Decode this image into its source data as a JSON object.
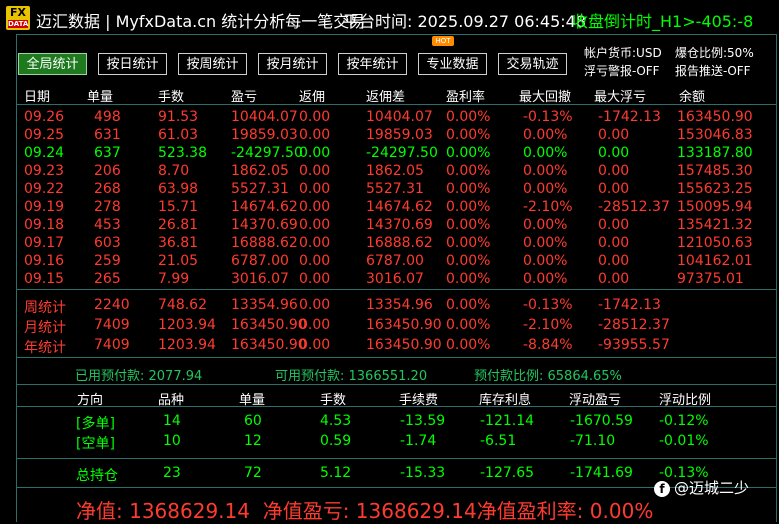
{
  "titlebar": {
    "logo_top": "FX",
    "logo_bottom": "DATA",
    "title": "迈汇数据 | MyfxData.cn  统计分析每一笔交易",
    "time": "平台时间: 2025.09.27 06:45:48",
    "countdown": "收盘倒计时_H1>-405:-8"
  },
  "buttons": [
    {
      "label": "全局统计",
      "active": true
    },
    {
      "label": "按日统计",
      "active": false
    },
    {
      "label": "按周统计",
      "active": false
    },
    {
      "label": "按月统计",
      "active": false
    },
    {
      "label": "按年统计",
      "active": false
    },
    {
      "label": "专业数据",
      "active": false
    },
    {
      "label": "交易轨迹",
      "active": false
    }
  ],
  "hot_badge": "HOT",
  "info": {
    "currency": "帐户货币:USD",
    "ratio": "爆仓比例:50%",
    "alert": "浮亏警报-OFF",
    "report": "报告推送-OFF"
  },
  "table": {
    "headers": [
      "日期",
      "单量",
      "手数",
      "盈亏",
      "返佣",
      "返佣差",
      "盈利率",
      "最大回撤",
      "最大浮亏",
      "余额"
    ],
    "rows": [
      {
        "color": "red",
        "cells": [
          "09.26",
          "498",
          "91.53",
          "10404.07",
          "0.00",
          "10404.07",
          "0.00%",
          "-0.13%",
          "-1742.13",
          "163450.90"
        ]
      },
      {
        "color": "red",
        "cells": [
          "09.25",
          "631",
          "61.03",
          "19859.03",
          "0.00",
          "19859.03",
          "0.00%",
          "0.00%",
          "0.00",
          "153046.83"
        ]
      },
      {
        "color": "green",
        "cells": [
          "09.24",
          "637",
          "523.38",
          "-24297.50",
          "0.00",
          "-24297.50",
          "0.00%",
          "0.00%",
          "0.00",
          "133187.80"
        ]
      },
      {
        "color": "red",
        "cells": [
          "09.23",
          "206",
          "8.70",
          "1862.05",
          "0.00",
          "1862.05",
          "0.00%",
          "0.00%",
          "0.00",
          "157485.30"
        ]
      },
      {
        "color": "red",
        "cells": [
          "09.22",
          "268",
          "63.98",
          "5527.31",
          "0.00",
          "5527.31",
          "0.00%",
          "0.00%",
          "0.00",
          "155623.25"
        ]
      },
      {
        "color": "red",
        "cells": [
          "09.19",
          "278",
          "15.71",
          "14674.62",
          "0.00",
          "14674.62",
          "0.00%",
          "-2.10%",
          "-28512.37",
          "150095.94"
        ]
      },
      {
        "color": "red",
        "cells": [
          "09.18",
          "453",
          "26.81",
          "14370.69",
          "0.00",
          "14370.69",
          "0.00%",
          "0.00%",
          "0.00",
          "135421.32"
        ]
      },
      {
        "color": "red",
        "cells": [
          "09.17",
          "603",
          "36.81",
          "16888.62",
          "0.00",
          "16888.62",
          "0.00%",
          "0.00%",
          "0.00",
          "121050.63"
        ]
      },
      {
        "color": "red",
        "cells": [
          "09.16",
          "259",
          "21.05",
          "6787.00",
          "0.00",
          "6787.00",
          "0.00%",
          "0.00%",
          "0.00",
          "104162.01"
        ]
      },
      {
        "color": "red",
        "cells": [
          "09.15",
          "265",
          "7.99",
          "3016.07",
          "0.00",
          "3016.07",
          "0.00%",
          "0.00%",
          "0.00",
          "97375.01"
        ]
      }
    ],
    "totals": [
      {
        "color": "red",
        "cells": [
          "周统计",
          "2240",
          "748.62",
          "13354.96",
          "0.00",
          "13354.96",
          "0.00%",
          "-0.13%",
          "-1742.13",
          ""
        ]
      },
      {
        "color": "red",
        "cells": [
          "月统计",
          "7409",
          "1203.94",
          "163450.90",
          "0.00",
          "163450.90",
          "0.00%",
          "-2.10%",
          "-28512.37",
          ""
        ]
      },
      {
        "color": "red",
        "cells": [
          "年统计",
          "7409",
          "1203.94",
          "163450.90",
          "0.00",
          "163450.90",
          "0.00%",
          "-8.84%",
          "-93955.57",
          ""
        ]
      }
    ]
  },
  "margin": {
    "used": "已用预付款: 2077.94",
    "available": "可用预付款: 1366551.20",
    "ratio": "预付款比例: 65864.65%"
  },
  "positions": {
    "headers": [
      "方向",
      "品种",
      "单量",
      "手数",
      "手续费",
      "库存利息",
      "浮动盈亏",
      "浮动比例"
    ],
    "rows": [
      {
        "color": "green",
        "cells": [
          "[多单]",
          "14",
          "60",
          "4.53",
          "-13.59",
          "-121.14",
          "-1670.59",
          "-0.12%"
        ]
      },
      {
        "color": "green",
        "cells": [
          "[空单]",
          "10",
          "12",
          "0.59",
          "-1.74",
          "-6.51",
          "-71.10",
          "-0.01%"
        ]
      }
    ],
    "total": {
      "color": "green",
      "cells": [
        "总持仓",
        "23",
        "72",
        "5.12",
        "-15.33",
        "-127.65",
        "-1741.69",
        "-0.13%"
      ]
    }
  },
  "footer": {
    "equity": "净值: 1368629.14",
    "equity_profit": "净值盈亏: 1368629.14",
    "equity_rate": "净值盈利率: 0.00%"
  },
  "watermark": {
    "icon": "f",
    "text": "@迈城二少"
  }
}
